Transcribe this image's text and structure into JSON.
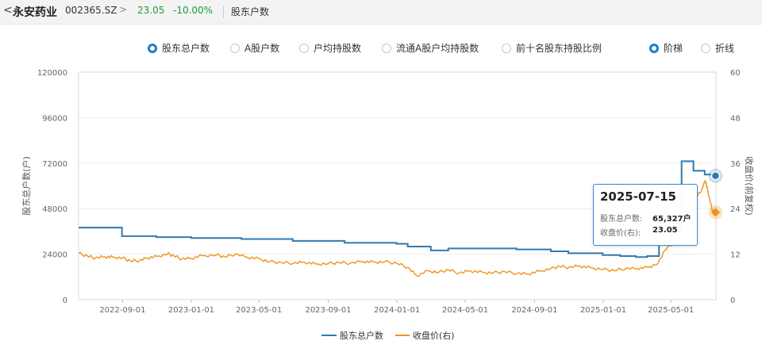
{
  "header": {
    "back_icon": "<",
    "stock_name": "永安药业",
    "stock_code": "002365.SZ",
    "chevron": ">",
    "price": "23.05",
    "change": "-10.00%",
    "breadcrumb": "股东户数"
  },
  "options": [
    {
      "label": "股东总户数",
      "selected": true
    },
    {
      "label": "A股户数",
      "selected": false
    },
    {
      "label": "户均持股数",
      "selected": false
    },
    {
      "label": "流通A股户均持股数",
      "selected": false
    },
    {
      "label": "前十名股东持股比例",
      "selected": false
    }
  ],
  "modes": [
    {
      "label": "阶梯",
      "selected": true
    },
    {
      "label": "折线",
      "selected": false
    }
  ],
  "tooltip": {
    "date": "2025-07-15",
    "row1_label": "股东总户数:",
    "row1_value": "65,327户",
    "row2_label": "收盘价(右):",
    "row2_value": "23.05"
  },
  "colors": {
    "holders": "#2f7bb0",
    "price": "#f0931e",
    "accent": "#1a7fc0",
    "down": "#1a9b3c"
  },
  "chart_data": {
    "type": "line",
    "ylabel_left": "股东总户数(户)",
    "ylabel_right": "收盘价(前复权)",
    "y_left_ticks": [
      "0",
      "24000",
      "48000",
      "72000",
      "96000",
      "120000"
    ],
    "y_left_range": [
      0,
      120000
    ],
    "y_right_ticks": [
      "0",
      "12",
      "24",
      "36",
      "48",
      "60"
    ],
    "y_right_range": [
      0,
      60
    ],
    "x_ticks": [
      "2022-09-01",
      "2023-01-01",
      "2023-05-01",
      "2023-09-01",
      "2024-01-01",
      "2024-05-01",
      "2024-09-01",
      "2025-01-01",
      "2025-05-01"
    ],
    "x_range": [
      "2022-06-15",
      "2025-07-20"
    ],
    "legend": [
      "股东总户数",
      "收盘价(右)"
    ],
    "series": [
      {
        "name": "股东总户数",
        "style": "step",
        "points": [
          [
            "2022-06-15",
            38000
          ],
          [
            "2022-08-10",
            38000
          ],
          [
            "2022-08-31",
            33500
          ],
          [
            "2022-10-31",
            33000
          ],
          [
            "2023-01-01",
            32500
          ],
          [
            "2023-03-31",
            32000
          ],
          [
            "2023-06-30",
            31000
          ],
          [
            "2023-09-30",
            30000
          ],
          [
            "2023-12-31",
            29500
          ],
          [
            "2024-01-20",
            28000
          ],
          [
            "2024-03-01",
            26000
          ],
          [
            "2024-04-01",
            27000
          ],
          [
            "2024-06-30",
            27000
          ],
          [
            "2024-07-31",
            26500
          ],
          [
            "2024-09-30",
            25500
          ],
          [
            "2024-10-31",
            24500
          ],
          [
            "2024-12-31",
            23500
          ],
          [
            "2025-01-31",
            23000
          ],
          [
            "2025-02-28",
            22500
          ],
          [
            "2025-03-20",
            23000
          ],
          [
            "2025-04-10",
            30000
          ],
          [
            "2025-05-01",
            36000
          ],
          [
            "2025-05-20",
            73000
          ],
          [
            "2025-06-10",
            68000
          ],
          [
            "2025-06-30",
            66000
          ],
          [
            "2025-07-15",
            65327
          ]
        ]
      },
      {
        "name": "收盘价(右)",
        "style": "line",
        "points": [
          [
            "2022-06-15",
            12.2
          ],
          [
            "2022-07-01",
            11.5
          ],
          [
            "2022-07-15",
            11.0
          ],
          [
            "2022-08-01",
            11.3
          ],
          [
            "2022-08-15",
            11.2
          ],
          [
            "2022-09-01",
            11.0
          ],
          [
            "2022-09-15",
            10.2
          ],
          [
            "2022-10-01",
            10.3
          ],
          [
            "2022-10-15",
            11.0
          ],
          [
            "2022-11-01",
            11.4
          ],
          [
            "2022-11-20",
            12.1
          ],
          [
            "2022-12-01",
            11.6
          ],
          [
            "2022-12-15",
            10.7
          ],
          [
            "2023-01-01",
            10.9
          ],
          [
            "2023-01-20",
            11.6
          ],
          [
            "2023-02-15",
            11.8
          ],
          [
            "2023-03-01",
            11.3
          ],
          [
            "2023-03-20",
            12.0
          ],
          [
            "2023-04-10",
            11.2
          ],
          [
            "2023-05-01",
            10.8
          ],
          [
            "2023-05-20",
            10.0
          ],
          [
            "2023-06-10",
            9.8
          ],
          [
            "2023-07-01",
            9.6
          ],
          [
            "2023-07-20",
            9.9
          ],
          [
            "2023-08-10",
            9.4
          ],
          [
            "2023-09-01",
            9.5
          ],
          [
            "2023-09-20",
            9.8
          ],
          [
            "2023-10-10",
            9.6
          ],
          [
            "2023-11-01",
            10.1
          ],
          [
            "2023-11-20",
            9.9
          ],
          [
            "2023-12-10",
            10.0
          ],
          [
            "2024-01-01",
            9.6
          ],
          [
            "2024-01-20",
            8.5
          ],
          [
            "2024-02-05",
            6.3
          ],
          [
            "2024-02-25",
            7.6
          ],
          [
            "2024-03-15",
            7.2
          ],
          [
            "2024-04-01",
            7.9
          ],
          [
            "2024-04-20",
            7.0
          ],
          [
            "2024-05-10",
            7.6
          ],
          [
            "2024-06-01",
            7.2
          ],
          [
            "2024-06-20",
            7.1
          ],
          [
            "2024-07-10",
            7.4
          ],
          [
            "2024-08-01",
            6.9
          ],
          [
            "2024-08-20",
            6.8
          ],
          [
            "2024-09-10",
            7.5
          ],
          [
            "2024-09-30",
            8.2
          ],
          [
            "2024-10-15",
            8.8
          ],
          [
            "2024-11-01",
            8.5
          ],
          [
            "2024-11-20",
            8.9
          ],
          [
            "2024-12-10",
            8.4
          ],
          [
            "2025-01-01",
            8.0
          ],
          [
            "2025-01-20",
            7.7
          ],
          [
            "2025-02-10",
            8.2
          ],
          [
            "2025-03-01",
            8.2
          ],
          [
            "2025-03-20",
            8.5
          ],
          [
            "2025-04-08",
            9.5
          ],
          [
            "2025-04-20",
            13.0
          ],
          [
            "2025-05-05",
            15.0
          ],
          [
            "2025-05-15",
            19.0
          ],
          [
            "2025-05-25",
            25.0
          ],
          [
            "2025-06-05",
            21.0
          ],
          [
            "2025-06-15",
            27.0
          ],
          [
            "2025-06-25",
            29.0
          ],
          [
            "2025-07-01",
            31.5
          ],
          [
            "2025-07-05",
            29.0
          ],
          [
            "2025-07-10",
            25.6
          ],
          [
            "2025-07-15",
            23.05
          ]
        ]
      }
    ]
  }
}
